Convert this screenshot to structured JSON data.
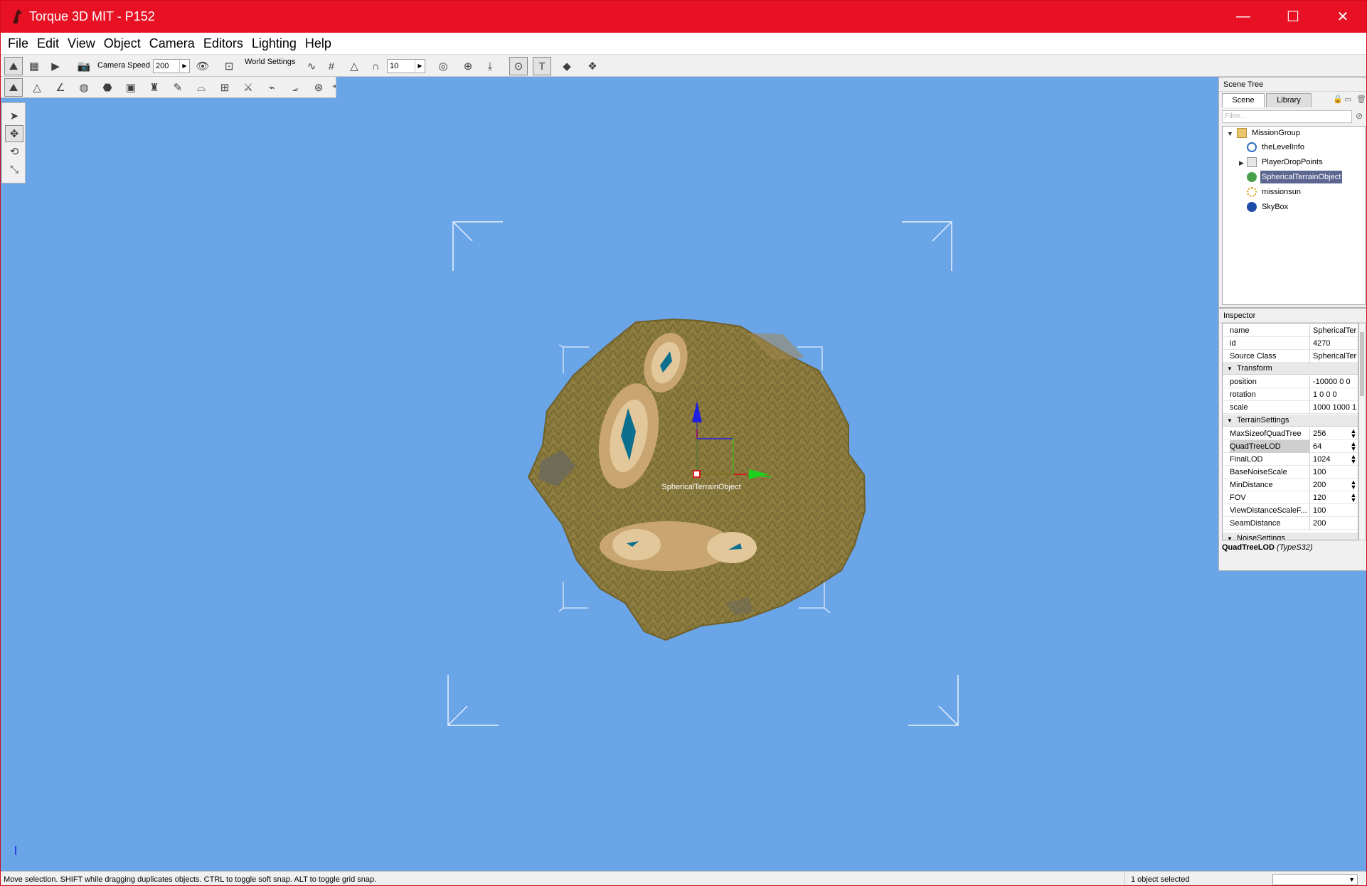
{
  "window": {
    "title": "Torque 3D MIT - P152",
    "minimize_glyph": "—",
    "maximize_glyph": "☐",
    "close_glyph": "✕"
  },
  "menu": [
    "File",
    "Edit",
    "View",
    "Object",
    "Camera",
    "Editors",
    "Lighting",
    "Help"
  ],
  "toolbar": {
    "camera_speed_label": "Camera Speed",
    "camera_speed_value": "200",
    "world_settings_label": "World Settings",
    "snap_value": "10"
  },
  "viewport": {
    "selected_object_label": "SphericalTerrainObject",
    "background_color": "#6aa5e8"
  },
  "scene_tree": {
    "title": "Scene Tree",
    "tabs": [
      "Scene",
      "Library"
    ],
    "filter_placeholder": "Filter...",
    "nodes": [
      {
        "label": "MissionGroup",
        "icon": "folder-open-icon"
      },
      {
        "label": "theLevelInfo",
        "icon": "info-icon"
      },
      {
        "label": "PlayerDropPoints",
        "icon": "folder-icon"
      },
      {
        "label": "SphericalTerrainObject",
        "icon": "terrain-icon",
        "selected": true
      },
      {
        "label": "missionsun",
        "icon": "sun-icon"
      },
      {
        "label": "SkyBox",
        "icon": "skybox-icon"
      }
    ]
  },
  "inspector": {
    "title": "Inspector",
    "fields": [
      {
        "name": "name",
        "value": "SphericalTer"
      },
      {
        "name": "id",
        "value": "4270"
      },
      {
        "name": "Source Class",
        "value": "SphericalTer"
      }
    ],
    "transform_group": "Transform",
    "transform": [
      {
        "name": "position",
        "value": "-10000 0 0"
      },
      {
        "name": "rotation",
        "value": "1 0 0 0"
      },
      {
        "name": "scale",
        "value": "1000 1000 1"
      }
    ],
    "terrain_group": "TerrainSettings",
    "terrain": [
      {
        "name": "MaxSizeofQuadTree",
        "value": "256"
      },
      {
        "name": "QuadTreeLOD",
        "value": "64"
      },
      {
        "name": "FinalLOD",
        "value": "1024"
      },
      {
        "name": "BaseNoiseScale",
        "value": "100"
      },
      {
        "name": "MinDistance",
        "value": "200"
      },
      {
        "name": "FOV",
        "value": "120"
      },
      {
        "name": "ViewDistanceScaleF...",
        "value": "100"
      },
      {
        "name": "SeamDistance",
        "value": "200"
      }
    ],
    "next_group": "NoiseSettings",
    "description_field": "QuadTreeLOD",
    "description_type": "(TypeS32)"
  },
  "status": {
    "message": "Move selection.  SHIFT while dragging duplicates objects.  CTRL to toggle soft snap.  ALT to toggle grid snap.",
    "selection": "1 object selected"
  }
}
